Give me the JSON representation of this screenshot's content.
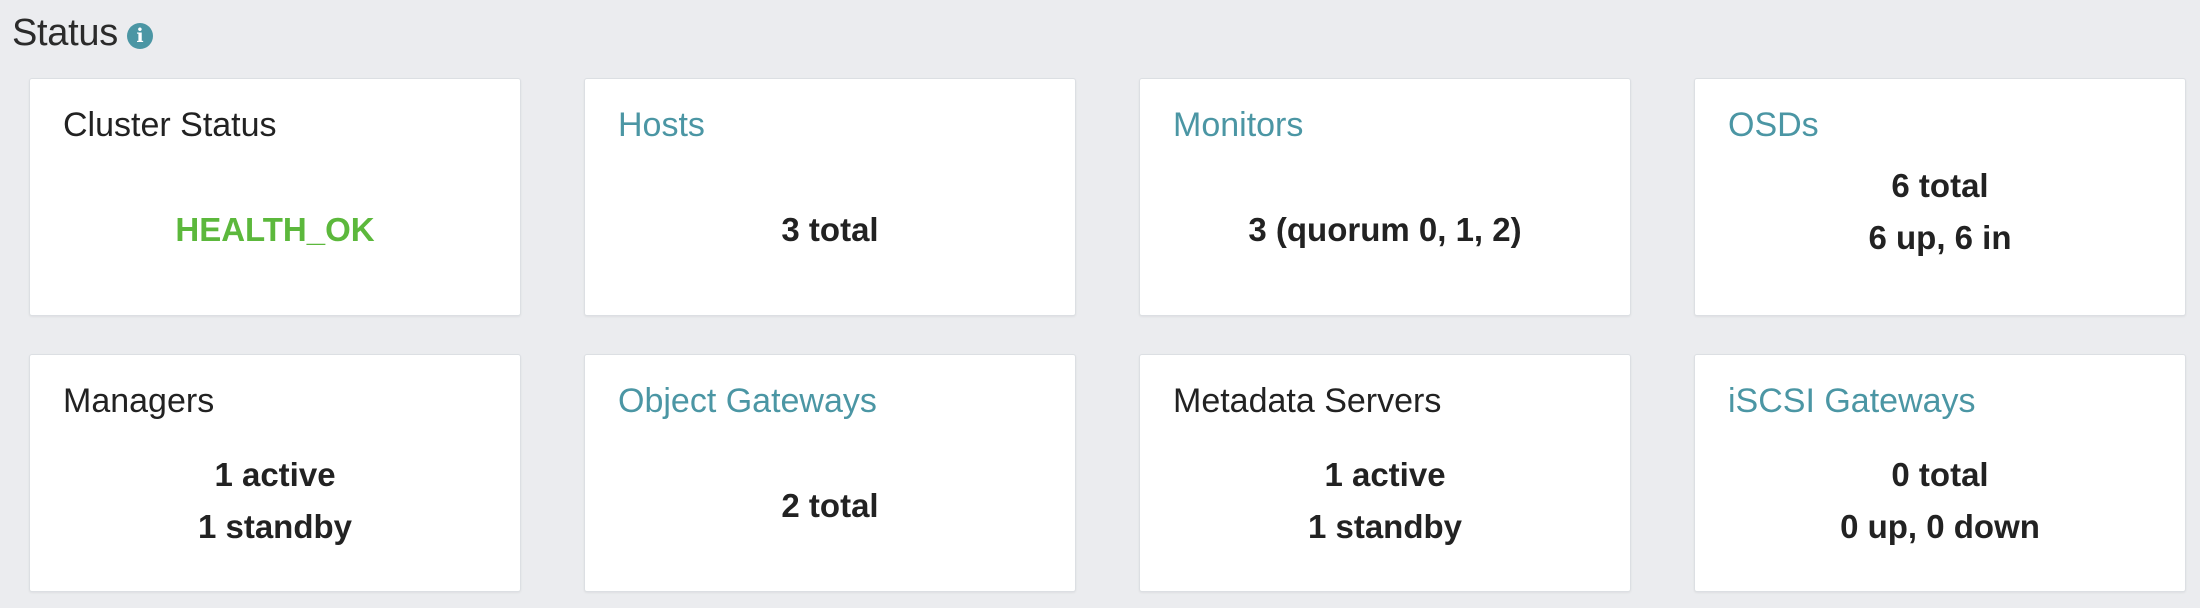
{
  "header": {
    "title": "Status",
    "info_icon": "info-circle-icon"
  },
  "colors": {
    "link": "#4b96a4",
    "health_ok": "#5cb83c",
    "background": "#ebecef"
  },
  "cards": {
    "cluster_status": {
      "title": "Cluster Status",
      "value": "HEALTH_OK"
    },
    "hosts": {
      "title": "Hosts",
      "value": "3 total"
    },
    "monitors": {
      "title": "Monitors",
      "value": "3 (quorum 0, 1, 2)"
    },
    "osds": {
      "title": "OSDs",
      "line1": "6 total",
      "line2": "6 up, 6 in"
    },
    "managers": {
      "title": "Managers",
      "line1": "1 active",
      "line2": "1 standby"
    },
    "object_gateways": {
      "title": "Object Gateways",
      "value": "2 total"
    },
    "metadata_servers": {
      "title": "Metadata Servers",
      "line1": "1 active",
      "line2": "1 standby"
    },
    "iscsi_gateways": {
      "title": "iSCSI Gateways",
      "line1": "0 total",
      "line2": "0 up, 0 down"
    }
  }
}
